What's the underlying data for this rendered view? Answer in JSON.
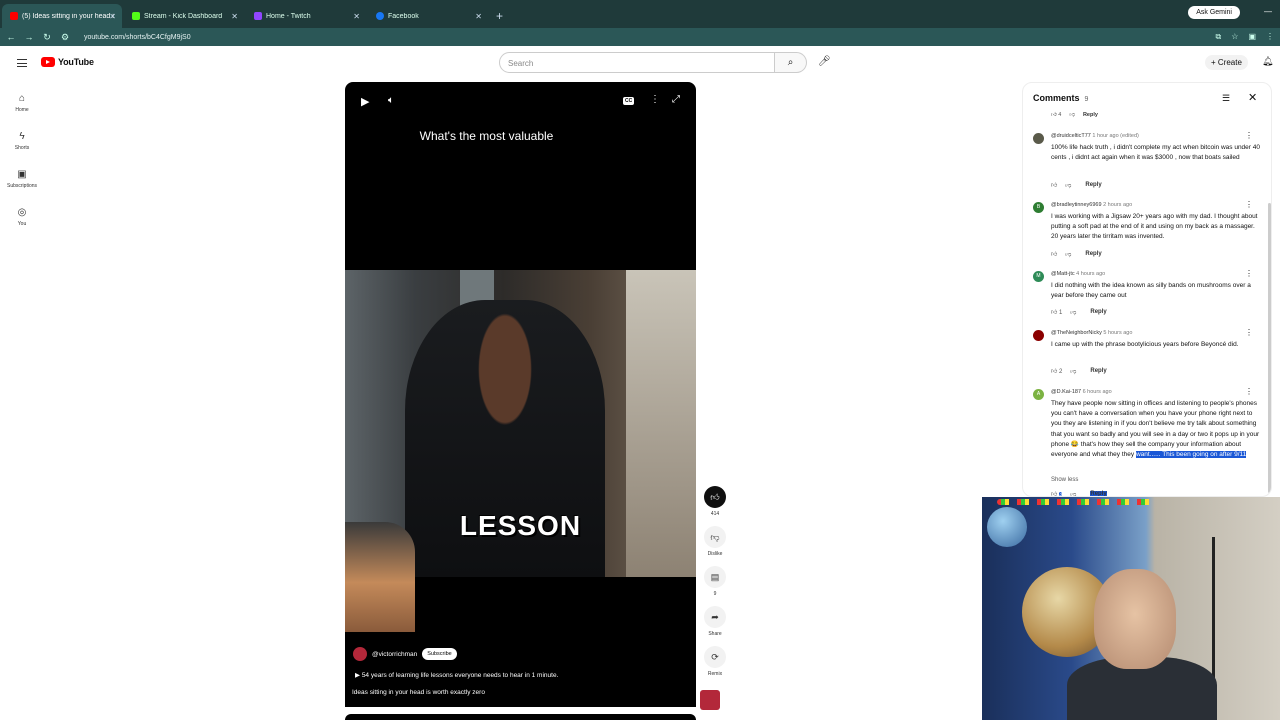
{
  "browser": {
    "tabs": [
      {
        "title": "(5) Ideas sitting in your head is",
        "fav_color": "#ff0000",
        "active": true
      },
      {
        "title": "Stream - Kick Dashboard",
        "fav_color": "#53fc18",
        "active": false
      },
      {
        "title": "Home - Twitch",
        "fav_color": "#9146ff",
        "active": false
      },
      {
        "title": "Facebook",
        "fav_color": "#1877f2",
        "active": false
      }
    ],
    "new_tab": "+",
    "ask_gemini": "Ask Gemini",
    "url": "youtube.com/shorts/bC4CfgM9jS0"
  },
  "yt_header": {
    "logo": "YouTube",
    "search_placeholder": "Search",
    "create_label": "Create"
  },
  "sidebar": [
    {
      "label": "Home",
      "icon": "home-icon"
    },
    {
      "label": "Shorts",
      "icon": "shorts-icon"
    },
    {
      "label": "Subscriptions",
      "icon": "subscriptions-icon"
    },
    {
      "label": "You",
      "icon": "you-icon"
    }
  ],
  "video": {
    "caption_top": "What's the most valuable",
    "caption_big": "LESSON",
    "channel": "@victorrichman",
    "subscribe": "Subscribe",
    "desc_line1": "54 years of learning life lessons everyone needs to hear in 1 minute.",
    "desc_line2": "Ideas sitting in your head is worth  exactly zero"
  },
  "actions": [
    {
      "name": "like-button",
      "label": "414",
      "icon": "thumb-up-icon"
    },
    {
      "name": "dislike-button",
      "label": "Dislike",
      "icon": "thumb-down-icon"
    },
    {
      "name": "comments-button",
      "label": "9",
      "icon": "comment-icon"
    },
    {
      "name": "share-button",
      "label": "Share",
      "icon": "share-icon"
    },
    {
      "name": "remix-button",
      "label": "Remix",
      "icon": "remix-icon"
    }
  ],
  "comments": {
    "title": "Comments",
    "count": "9",
    "first_row": {
      "likes": "4",
      "reply": "Reply"
    },
    "items": [
      {
        "author": "@druidcelticT77",
        "time": "1 hour ago (edited)",
        "avatar_color": "#5a5a4a",
        "body": "100% life hack truth , i didn't complete my act when bitcoin was under 40 cents , i didnt act again when it was $3000 , now that boats sailed",
        "likes": "",
        "reply": "Reply"
      },
      {
        "author": "@bradleytinney6969",
        "time": "2 hours ago",
        "avatar_color": "#2e7d32",
        "initial": "B",
        "body": "I was working with a Jigsaw 20+ years ago with my dad. I thought about putting a soft pad at the end of it and using on my back as a massager. 20 years later the tirritam was invented.",
        "likes": "",
        "reply": "Reply"
      },
      {
        "author": "@Matt-jtc",
        "time": "4 hours ago",
        "avatar_color": "#2e8b57",
        "initial": "M",
        "body": "I did nothing with the idea known as silly bands on mushrooms over a year before they came out",
        "likes": "1",
        "reply": "Reply"
      },
      {
        "author": "@TheNeighborNicky",
        "time": "5 hours ago",
        "avatar_color": "#8b0000",
        "initial": "",
        "body": "I came up with the phrase bootylicious years before Beyoncé did.",
        "likes": "2",
        "reply": "Reply"
      },
      {
        "author": "@D.Kai-187",
        "time": "6 hours ago",
        "avatar_color": "#7cb342",
        "initial": "A",
        "body": "They have people now sitting in offices and listening to people's phones you can't have a conversation when you have your phone right next to you they are listening in if you don't believe me try talk about something that you want so badly and you will see in a day or two it pops up in your phone 😂 that's how they sell the company your information about everyone and what they they",
        "highlight": "want...... This been going on after 9/11",
        "show_less": "Show less",
        "likes": "3",
        "reply": "Reply"
      }
    ]
  }
}
